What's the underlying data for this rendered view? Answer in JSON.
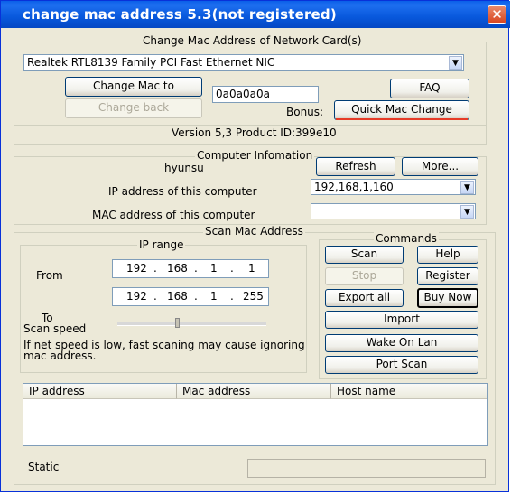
{
  "window": {
    "title": "change mac address 5.3(not registered)",
    "close_glyph": "✕"
  },
  "network": {
    "group_label": "Change Mac Address of Network Card(s)",
    "adapter": "Realtek RTL8139 Family PCI Fast Ethernet NIC",
    "change_mac_label": "Change Mac to",
    "mac_value": "0a0a0a0a",
    "change_back_label": "Change back",
    "faq_label": "FAQ",
    "bonus_label": "Bonus:",
    "quick_change_label": "Quick Mac Change",
    "version_text": "Version 5,3  Product ID:399e10"
  },
  "computer": {
    "group_label": "Computer Infomation",
    "hostname": "hyunsu",
    "refresh_label": "Refresh",
    "more_label": "More...",
    "ip_label": "IP address of this computer",
    "ip_value": "192,168,1,160",
    "mac_label": "MAC address of this computer",
    "mac_value": ""
  },
  "scan": {
    "group_label": "Scan Mac Address",
    "ip_range_label": "IP range",
    "from_label": "From",
    "to_label": "To",
    "from_ip": [
      "192",
      "168",
      "1",
      "1"
    ],
    "to_ip": [
      "192",
      "168",
      "1",
      "255"
    ],
    "dot": ".",
    "speed_label": "Scan speed",
    "warning_line1": "If net speed is low,  fast scaning may cause ignoring",
    "warning_line2": "mac address.",
    "speed_level": 0.4
  },
  "commands": {
    "group_label": "Commands",
    "scan": "Scan",
    "help": "Help",
    "stop": "Stop",
    "register": "Register",
    "export_all": "Export all",
    "buy_now": "Buy Now",
    "import": "Import",
    "wake_on_lan": "Wake On Lan",
    "port_scan": "Port Scan"
  },
  "results": {
    "columns": [
      "IP address",
      "Mac address",
      "Host name"
    ]
  },
  "status": {
    "label": "Static"
  },
  "icons": {
    "combo_arrow": "chevron-down-icon",
    "arrow_glyph": "▼"
  }
}
